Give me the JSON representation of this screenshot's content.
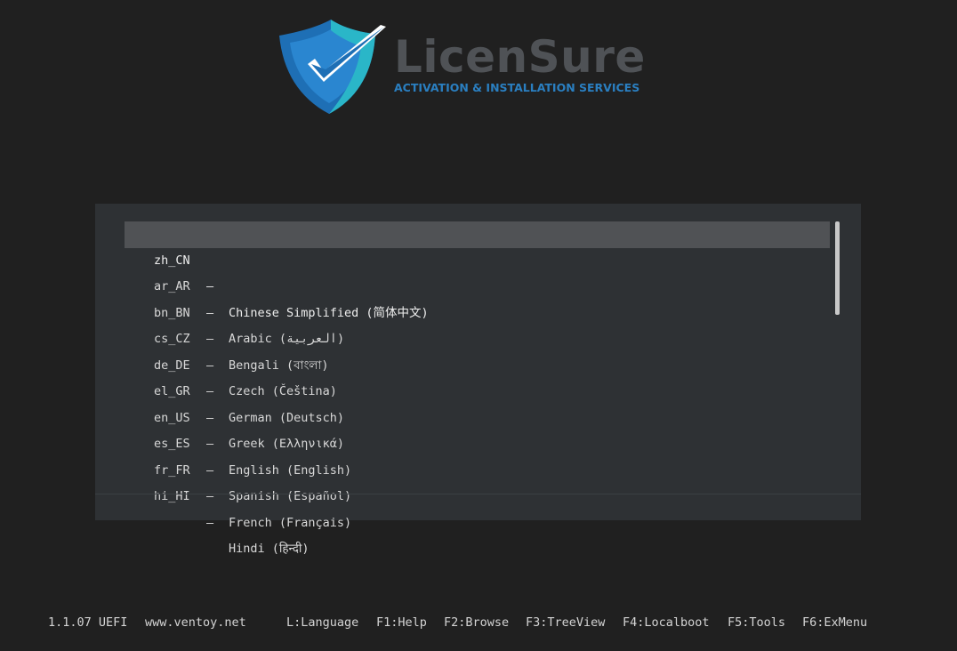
{
  "logo": {
    "name": "LicenSure",
    "tagline": "ACTIVATION & INSTALLATION SERVICES",
    "colors": {
      "shield_dark": "#1e6fb5",
      "shield_light": "#2ab6c8",
      "name_text": "#4f5256",
      "tagline_text": "#2a7fc1"
    }
  },
  "menu": {
    "selected_index": 0,
    "items": [
      {
        "code": "zh_CN",
        "dash": "–",
        "name": "Chinese Simplified (简体中文)"
      },
      {
        "code": "ar_AR",
        "dash": "–",
        "name": "Arabic (العربية)"
      },
      {
        "code": "bn_BN",
        "dash": "–",
        "name": "Bengali (বাংলা)"
      },
      {
        "code": "cs_CZ",
        "dash": "–",
        "name": "Czech (Čeština)"
      },
      {
        "code": "de_DE",
        "dash": "–",
        "name": "German (Deutsch)"
      },
      {
        "code": "el_GR",
        "dash": "–",
        "name": "Greek (Ελληνικά)"
      },
      {
        "code": "en_US",
        "dash": "–",
        "name": "English (English)"
      },
      {
        "code": "es_ES",
        "dash": "–",
        "name": "Spanish (Español)"
      },
      {
        "code": "fr_FR",
        "dash": "–",
        "name": "French (Français)"
      },
      {
        "code": "hi_HI",
        "dash": "–",
        "name": "Hindi (हिन्दी)"
      }
    ]
  },
  "footer": {
    "version": "1.1.07 UEFI",
    "website": "www.ventoy.net",
    "keys": {
      "language": "L:Language",
      "help": "F1:Help",
      "browse": "F2:Browse",
      "treeview": "F3:TreeView",
      "localboot": "F4:Localboot",
      "tools": "F5:Tools",
      "exmenu": "F6:ExMenu"
    }
  }
}
